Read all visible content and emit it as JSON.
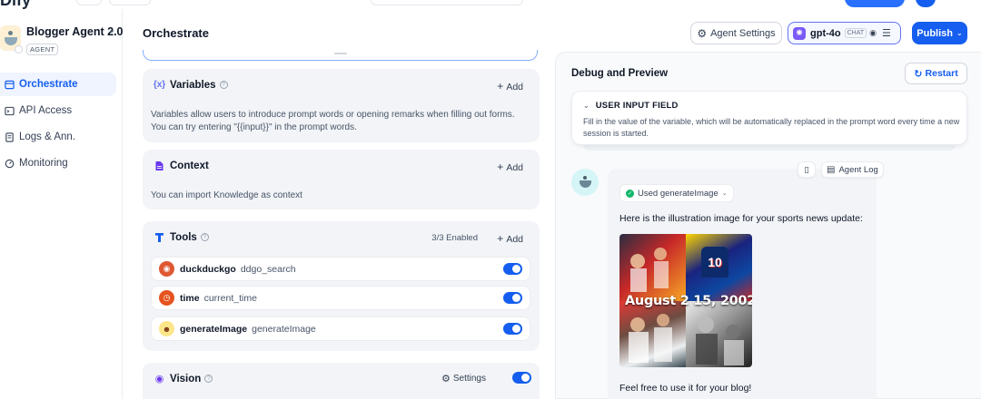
{
  "app": {
    "name": "Blogger Agent 2.0",
    "type_badge": "AGENT"
  },
  "sidebar": {
    "items": [
      {
        "label": "Orchestrate",
        "icon": "layout-icon",
        "active": true
      },
      {
        "label": "API Access",
        "icon": "terminal-icon",
        "active": false
      },
      {
        "label": "Logs & Ann.",
        "icon": "logs-icon",
        "active": false
      },
      {
        "label": "Monitoring",
        "icon": "monitoring-icon",
        "active": false
      }
    ]
  },
  "header": {
    "title": "Orchestrate",
    "agent_settings_label": "Agent Settings",
    "model": {
      "name": "gpt-4o",
      "mode": "CHAT"
    },
    "publish_label": "Publish"
  },
  "variables": {
    "title": "Variables",
    "add_label": "Add",
    "description": "Variables allow users to introduce prompt words or opening remarks when filling out forms. You can try entering \"{{input}}\" in the prompt words."
  },
  "context": {
    "title": "Context",
    "add_label": "Add",
    "description": "You can import Knowledge as context"
  },
  "tools": {
    "title": "Tools",
    "enabled_count": "3/3 Enabled",
    "add_label": "Add",
    "items": [
      {
        "name": "duckduckgo",
        "function": "ddgo_search",
        "enabled": true,
        "icon": "duckduckgo-icon",
        "color": "#de5833"
      },
      {
        "name": "time",
        "function": "current_time",
        "enabled": true,
        "icon": "clock-icon",
        "color": "#e6531f"
      },
      {
        "name": "generateImage",
        "function": "generateImage",
        "enabled": true,
        "icon": "robot-icon",
        "color": "#fde68a"
      }
    ]
  },
  "vision": {
    "title": "Vision",
    "settings_label": "Settings",
    "enabled": true
  },
  "debug": {
    "title": "Debug and Preview",
    "restart_label": "Restart",
    "user_input_field": {
      "title": "USER INPUT FIELD",
      "description": "Fill in the value of the variable, which will be automatically replaced in the prompt word every time a new session is started."
    },
    "message": {
      "agent_log_label": "Agent Log",
      "used_tool": "Used generateImage",
      "intro": "Here is the illustration image for your sports news update:",
      "image_text": "August 2 15, 20024",
      "jersey_number": "10",
      "outro": "Feel free to use it for your blog!"
    }
  },
  "colors": {
    "primary": "#155eef",
    "active_bg": "#eff4ff",
    "card_bg": "#f2f4f7",
    "success": "#12b76a"
  }
}
